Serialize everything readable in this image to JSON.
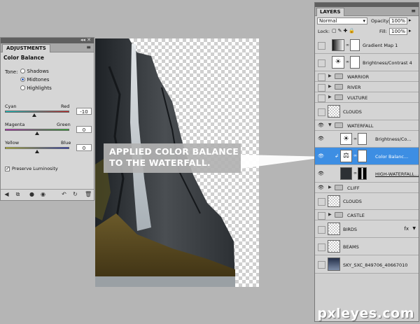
{
  "adjustments": {
    "tab_label": "ADJUSTMENTS",
    "title": "Color Balance",
    "tone_label": "Tone:",
    "tones": [
      {
        "label": "Shadows",
        "selected": false
      },
      {
        "label": "Midtones",
        "selected": true
      },
      {
        "label": "Highlights",
        "selected": false
      }
    ],
    "sliders": [
      {
        "left": "Cyan",
        "right": "Red",
        "value": "-10",
        "position": 0.45
      },
      {
        "left": "Magenta",
        "right": "Green",
        "value": "0",
        "position": 0.5
      },
      {
        "left": "Yellow",
        "right": "Blue",
        "value": "0",
        "position": 0.5
      }
    ],
    "preserve_label": "Preserve Luminosity",
    "preserve_checked": true
  },
  "layers": {
    "tab_label": "LAYERS",
    "blend_mode": "Normal",
    "opacity_label": "Opacity:",
    "opacity_value": "100%",
    "lock_label": "Lock:",
    "fill_label": "Fill:",
    "fill_value": "100%",
    "items": [
      {
        "name": "Gradient Map 1",
        "visible": false
      },
      {
        "name": "Brightness/Contrast 4",
        "visible": false
      },
      {
        "name": "WARRIOR",
        "visible": false
      },
      {
        "name": "RIVER",
        "visible": false
      },
      {
        "name": "VULTURE",
        "visible": false
      },
      {
        "name": "CLOUDS",
        "visible": false
      },
      {
        "name": "WATERFALL",
        "visible": true
      },
      {
        "name": "Brightness/Co...",
        "visible": true
      },
      {
        "name": "Color Balanc...",
        "visible": true
      },
      {
        "name": "HIGH-WATERFALL...",
        "visible": true
      },
      {
        "name": "CLIFF",
        "visible": true
      },
      {
        "name": "CLOUDS",
        "visible": false
      },
      {
        "name": "CASTLE",
        "visible": false
      },
      {
        "name": "BIRDS",
        "visible": false
      },
      {
        "name": "BEAMS",
        "visible": false
      },
      {
        "name": "SKY_SXC_849706_40667010",
        "visible": false
      }
    ]
  },
  "callout": {
    "line1": "APPLIED COLOR BALANCE",
    "line2": "TO THE WATERFALL."
  },
  "watermark": "pxleyes.com",
  "colors": {
    "selection": "#3d8ee3",
    "panel": "#d4d4d4",
    "workspace": "#b5b5b5"
  }
}
